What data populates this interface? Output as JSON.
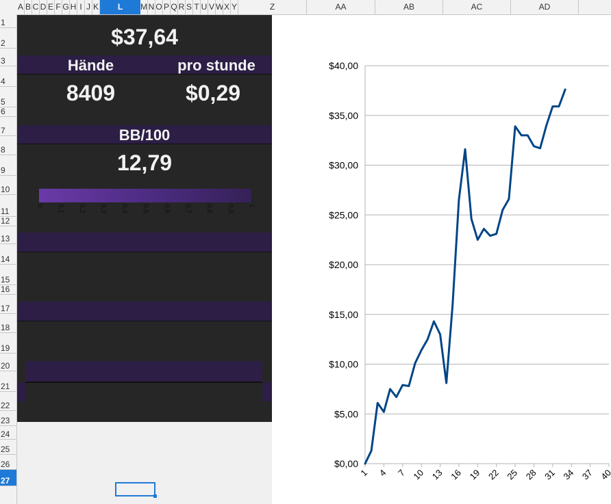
{
  "columns": [
    "A",
    "B",
    "C",
    "D",
    "E",
    "F",
    "G",
    "H",
    "I",
    "J",
    "K",
    "L",
    "M",
    "N",
    "O",
    "P",
    "Q",
    "R",
    "S",
    "T",
    "U",
    "V",
    "W",
    "X",
    "Y",
    "Z",
    "AA",
    "AB",
    "AC",
    "AD"
  ],
  "active_column": "L",
  "rows": [
    "1",
    "2",
    "3",
    "4",
    "5",
    "6",
    "7",
    "8",
    "9",
    "10",
    "11",
    "12",
    "13",
    "14",
    "15",
    "16",
    "17",
    "18",
    "19",
    "20",
    "21",
    "22",
    "23",
    "24",
    "25",
    "26",
    "27"
  ],
  "active_row": "27",
  "dashboard": {
    "total": "$37,64",
    "hands_label": "Hände",
    "per_hour_label": "pro stunde",
    "hands_value": "8409",
    "per_hour_value": "$0,29",
    "bb_label": "BB/100",
    "bb_value": "12,79",
    "bar_fill": 1.0,
    "scale_ticks": [
      "0",
      "0,1",
      "0,2",
      "0,3",
      "0,4",
      "0,5",
      "0,6",
      "0,7",
      "0,8",
      "0,9",
      "1"
    ]
  },
  "colors": {
    "dark_bg": "#262626",
    "band": "#2c1e45",
    "line": "#004586",
    "accent": "#1f7ad7"
  },
  "chart_data": {
    "type": "line",
    "x": [
      1,
      2,
      3,
      4,
      5,
      6,
      7,
      8,
      9,
      10,
      11,
      12,
      13,
      14,
      15,
      16,
      17,
      18,
      19,
      20,
      21,
      22,
      23,
      24,
      25,
      26,
      27,
      28,
      29,
      30,
      31,
      32,
      33
    ],
    "series": [
      {
        "values": [
          0,
          1.3,
          6.1,
          5.2,
          7.5,
          6.7,
          7.9,
          7.8,
          10.1,
          11.4,
          12.5,
          14.3,
          13.0,
          8.1,
          16.0,
          26.5,
          31.6,
          24.6,
          22.5,
          23.6,
          22.9,
          23.1,
          25.5,
          26.6,
          33.9,
          33.0,
          33.0,
          31.9,
          31.7,
          34.0,
          35.9,
          35.9,
          37.6
        ]
      }
    ],
    "title": "",
    "xlabel": "",
    "ylabel": "",
    "ylim": [
      0,
      40
    ],
    "xlim": [
      1,
      40
    ],
    "y_ticks": [
      "$0,00",
      "$5,00",
      "$10,00",
      "$15,00",
      "$20,00",
      "$25,00",
      "$30,00",
      "$35,00",
      "$40,00"
    ],
    "x_ticks": [
      "1",
      "4",
      "7",
      "10",
      "13",
      "16",
      "19",
      "22",
      "25",
      "28",
      "31",
      "34",
      "37",
      "40"
    ],
    "grid": true,
    "legend": "none"
  }
}
